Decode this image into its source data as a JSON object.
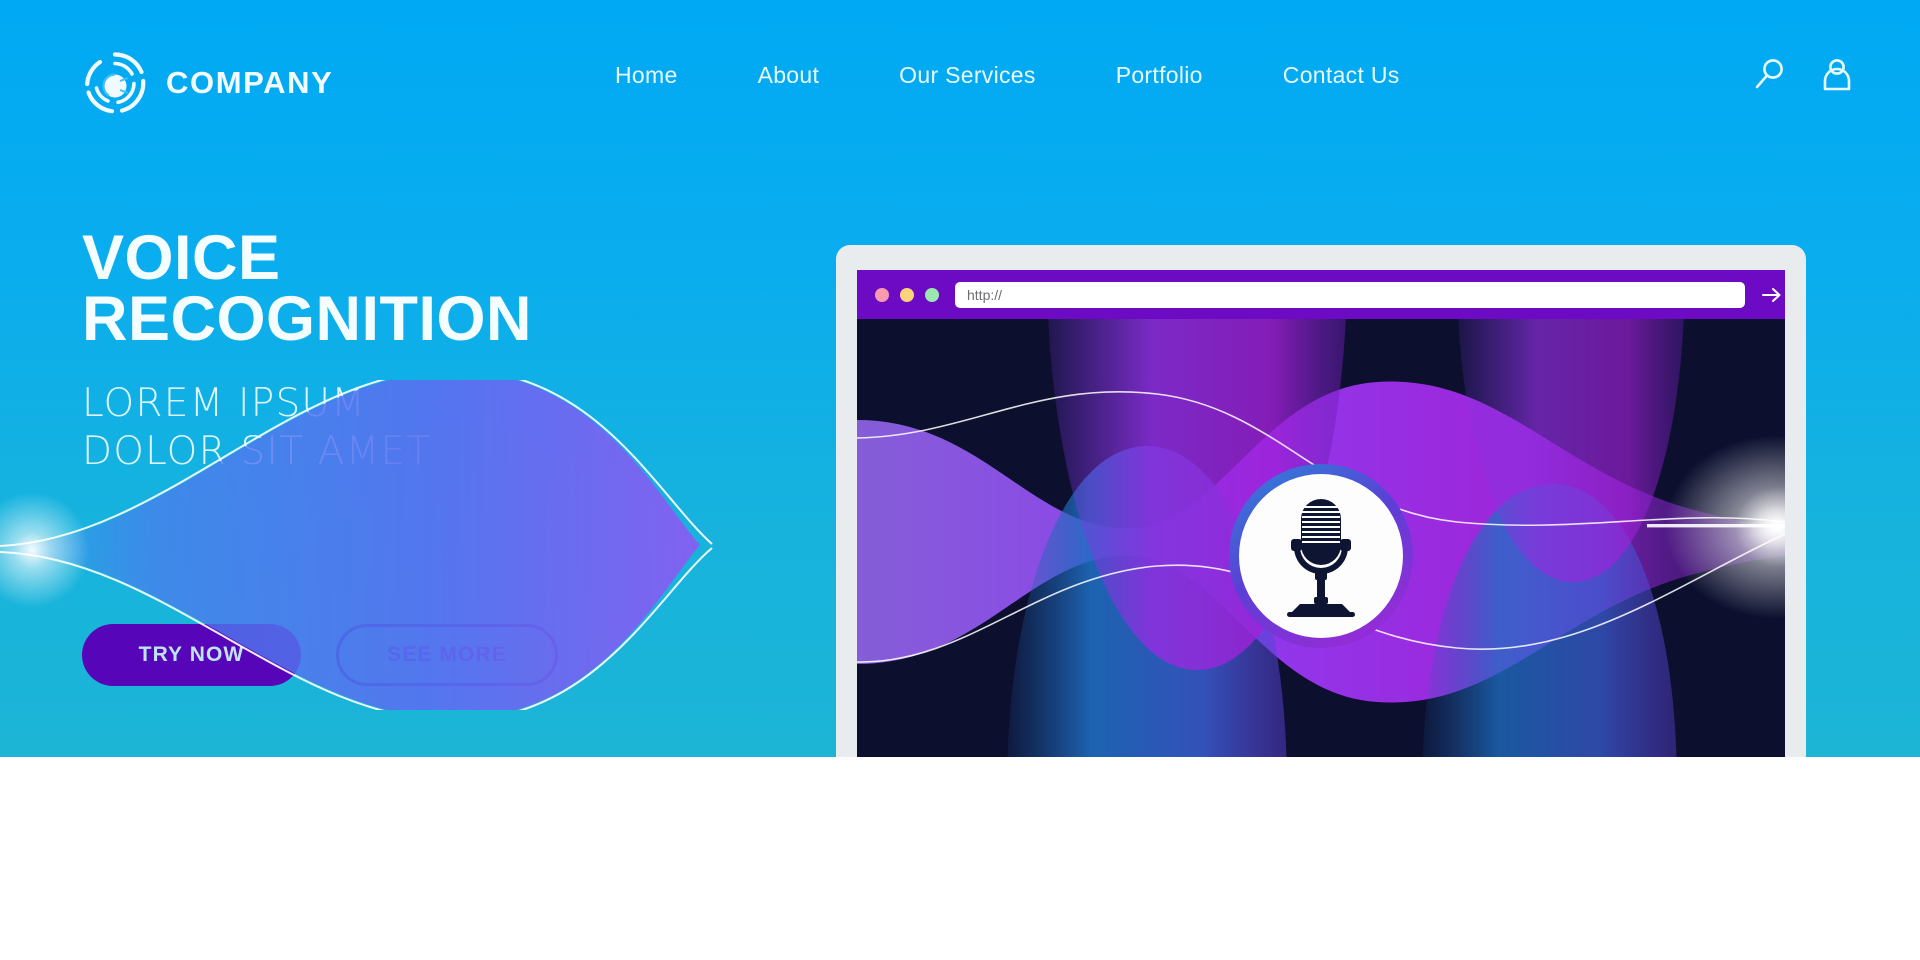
{
  "brand": {
    "name": "COMPANY",
    "logo_icon": "circular-swirl-logo-icon"
  },
  "nav": {
    "links": [
      {
        "label": "Home"
      },
      {
        "label": "About"
      },
      {
        "label": "Our Services"
      },
      {
        "label": "Portfolio"
      },
      {
        "label": "Contact Us"
      }
    ],
    "icons": [
      {
        "name": "search-icon"
      },
      {
        "name": "user-account-icon"
      }
    ]
  },
  "hero": {
    "title_line1": "VOICE",
    "title_line2": "RECOGNITION",
    "subtitle_line1": "LOREM IPSUM",
    "subtitle_line2": "DOLOR SIT AMET",
    "primary_button": "TRY NOW",
    "secondary_button": "SEE MORE"
  },
  "browser": {
    "url_placeholder": "http://",
    "url_value": "",
    "go_icon": "arrow-right-icon",
    "traffic_lights": [
      {
        "name": "close-dot",
        "color": "#f79ab0"
      },
      {
        "name": "minimize-dot",
        "color": "#fbd27c"
      },
      {
        "name": "maximize-dot",
        "color": "#9ce6b0"
      }
    ]
  },
  "illustration": {
    "mic_icon": "microphone-icon",
    "description": "voice waveform visualization"
  },
  "colors": {
    "hero_top": "#00a9f4",
    "hero_bottom": "#1cb5d6",
    "chrome_purple": "#6d0bc4",
    "primary_button_bg": "#5606b8",
    "secondary_button_border": "#1b28b0",
    "secondary_button_text": "#5a18c4",
    "screen_bg": "#0c0f2e",
    "laptop_body": "#e9ecee",
    "laptop_base": "#b4b6b6"
  }
}
